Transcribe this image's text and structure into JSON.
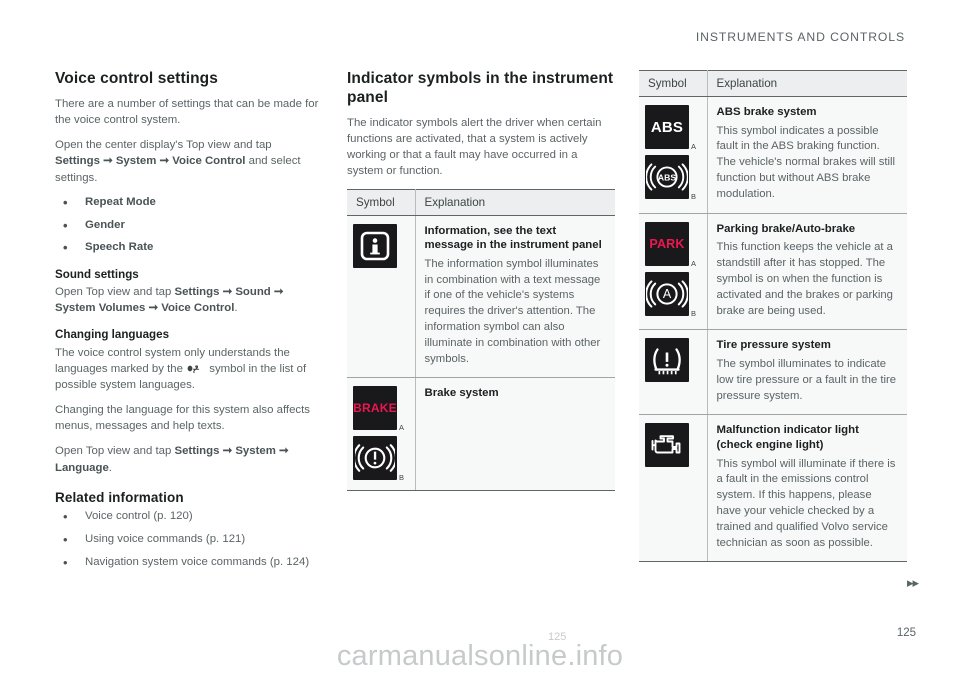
{
  "header": {
    "title": "INSTRUMENTS AND CONTROLS"
  },
  "footer": {
    "page_number": "125",
    "next_marker": "▸▸",
    "watermark": "carmanualsonline.info",
    "watermark_page": "125"
  },
  "col1": {
    "heading": "Voice control settings",
    "intro": "There are a number of settings that can be made for the voice control system.",
    "open_prefix": "Open the center display's Top view and tap",
    "path1": {
      "a": "Settings",
      "b": "System",
      "c": "Voice Control",
      "suffix": "and select settings."
    },
    "settings_list": [
      "Repeat Mode",
      "Gender",
      "Speech Rate"
    ],
    "sound_heading": "Sound settings",
    "sound_prefix": "Open Top view and tap",
    "sound_path": {
      "a": "Settings",
      "b": "Sound",
      "c": "System Volumes",
      "d": "Voice Control",
      "suffix": "."
    },
    "lang_heading": "Changing languages",
    "lang_text_1": "The voice control system only understands the",
    "lang_text_2": "languages marked by the",
    "lang_text_3": "symbol in the list of possible system languages.",
    "lang_text_4": "Changing the language for this system also affects menus, messages and help texts.",
    "lang_prefix": "Open Top view and tap",
    "lang_path": {
      "a": "Settings",
      "b": "System",
      "c": "Language",
      "suffix": "."
    },
    "related_heading": "Related information",
    "related_list": [
      "Voice control (p. 120)",
      "Using voice commands (p. 121)",
      "Navigation system voice commands (p. 124)"
    ]
  },
  "col2": {
    "heading": "Indicator symbols in the instrument panel",
    "intro": "The indicator symbols alert the driver when certain functions are activated, that a system is actively working or that a fault may have occurred in a system or function.",
    "table": {
      "columns": [
        "Symbol",
        "Explanation"
      ],
      "rows": [
        {
          "symbols": [
            {
              "icon": "information-symbol",
              "label": ""
            }
          ],
          "title": "Information, see the text message in the instrument panel",
          "text": "The information symbol illuminates in combination with a text message if one of the vehicle's systems requires the driver's attention. The information symbol can also illuminate in combination with other symbols."
        },
        {
          "symbols": [
            {
              "icon": "brake-text-symbol",
              "label": "A",
              "text": "BRAKE"
            },
            {
              "icon": "brake-exclamation-symbol",
              "label": "B"
            }
          ],
          "title": "Brake system",
          "text": ""
        }
      ]
    }
  },
  "col3": {
    "table": {
      "columns": [
        "Symbol",
        "Explanation"
      ],
      "rows": [
        {
          "symbols": [
            {
              "icon": "abs-text-symbol",
              "label": "A",
              "text": "ABS"
            },
            {
              "icon": "abs-ring-symbol",
              "label": "B",
              "text": "ABS"
            }
          ],
          "title": "ABS brake system",
          "text": "This symbol indicates a possible fault in the ABS braking function. The vehicle's normal brakes will still function but without ABS brake modulation."
        },
        {
          "symbols": [
            {
              "icon": "park-text-symbol",
              "label": "A",
              "text": "PARK"
            },
            {
              "icon": "auto-brake-symbol",
              "label": "B",
              "text": "A"
            }
          ],
          "title": "Parking brake/Auto-brake",
          "text": "This function keeps the vehicle at a standstill after it has stopped. The symbol is on when the function is activated and the brakes or parking brake are being used."
        },
        {
          "symbols": [
            {
              "icon": "tire-pressure-symbol",
              "label": ""
            }
          ],
          "title": "Tire pressure system",
          "text": "The symbol illuminates to indicate low tire pressure or a fault in the tire pressure system."
        },
        {
          "symbols": [
            {
              "icon": "check-engine-symbol",
              "label": ""
            }
          ],
          "title": "Malfunction indicator light (check engine light)",
          "text": "This symbol will illuminate if there is a fault in the emissions control system. If this happens, please have your vehicle checked by a trained and qualified Volvo service technician as soon as possible."
        }
      ]
    }
  },
  "colors": {
    "accent_pink": "#ec1651",
    "icon_bg": "#19191b",
    "table_header_bg": "#eceeef",
    "text": "#5b6466"
  }
}
